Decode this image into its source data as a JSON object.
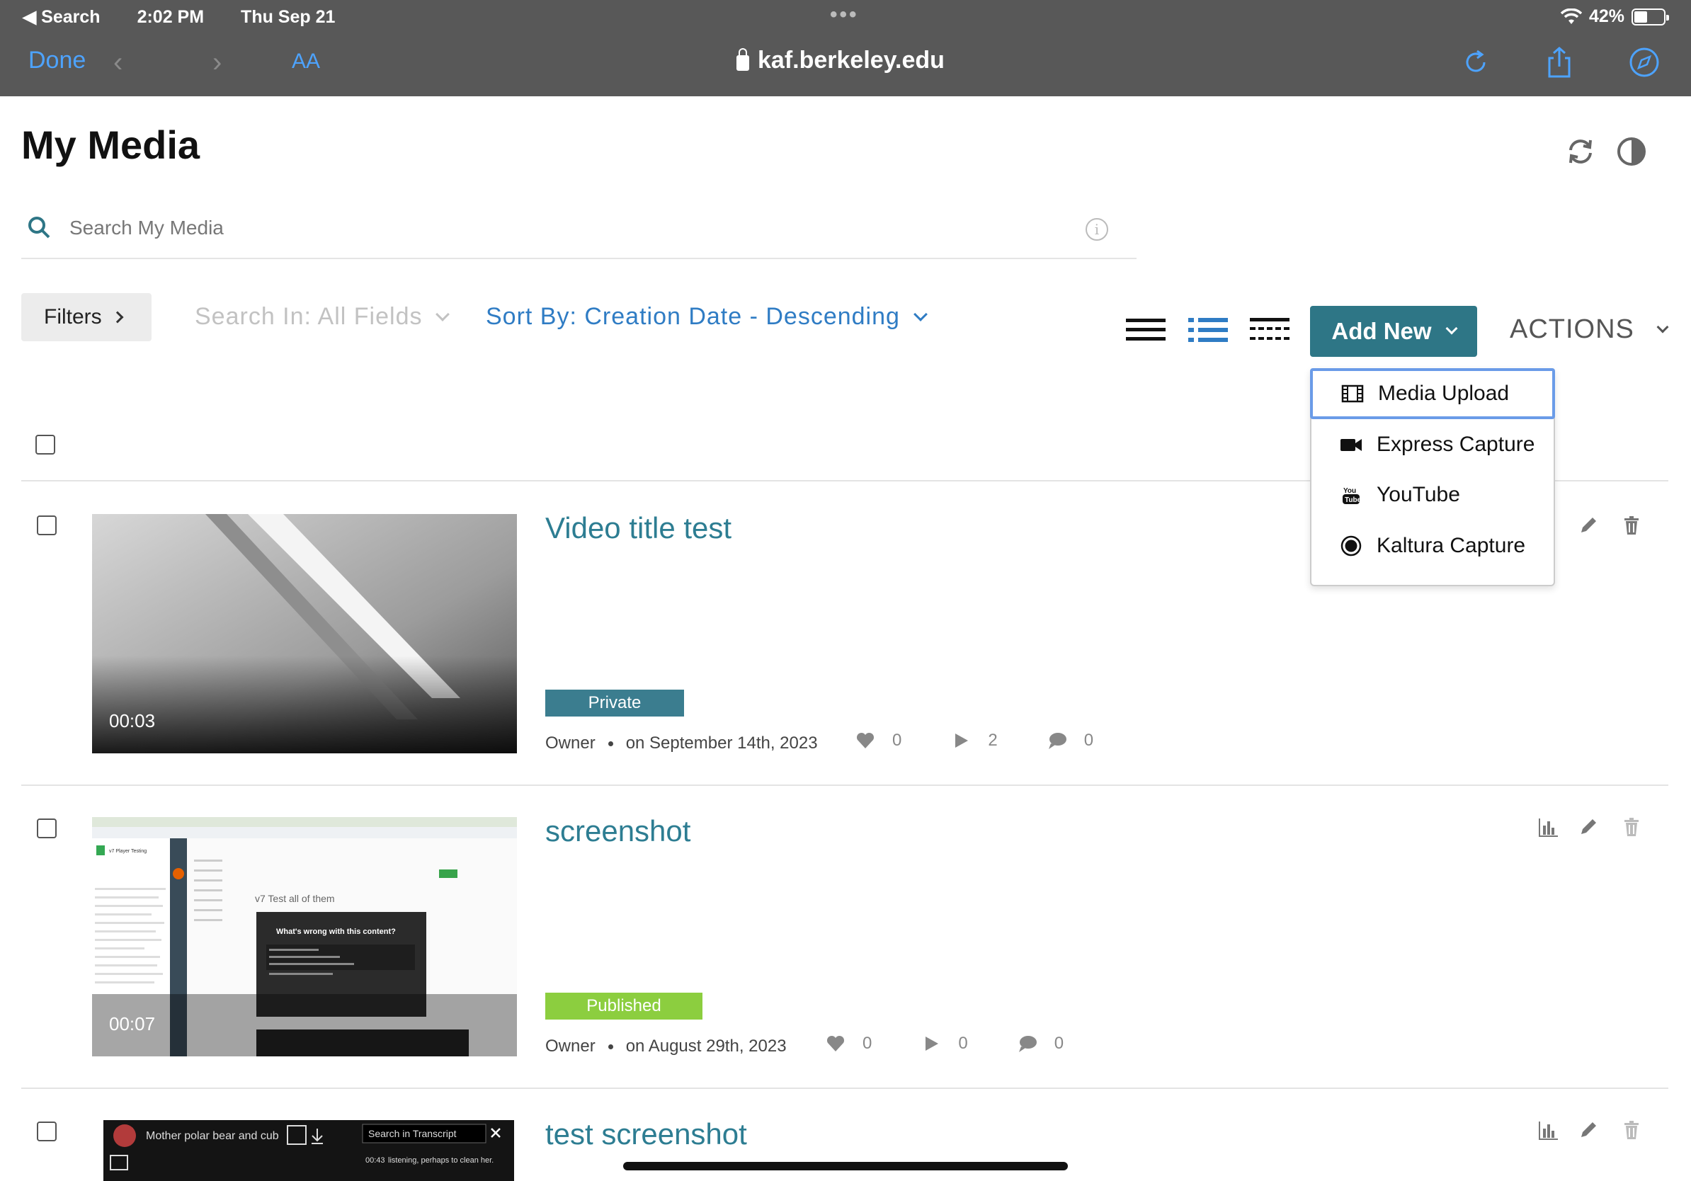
{
  "status_bar": {
    "back_label": "◀ Search",
    "time": "2:02 PM",
    "date": "Thu Sep 21",
    "battery": "42%"
  },
  "browser": {
    "done_label": "Done",
    "text_size_label": "AA",
    "url": "kaf.berkeley.edu"
  },
  "page": {
    "title": "My Media"
  },
  "search": {
    "placeholder": "Search My Media",
    "info_icon": "i"
  },
  "toolbar": {
    "filters_label": "Filters",
    "search_in_label": "Search In: All Fields",
    "sort_by_label": "Sort By: Creation Date - Descending",
    "add_new_label": "Add New",
    "actions_label": "ACTIONS"
  },
  "add_new_menu": {
    "items": [
      {
        "label": "Media Upload",
        "icon": "film-icon"
      },
      {
        "label": "Express Capture",
        "icon": "video-camera-icon"
      },
      {
        "label": "YouTube",
        "icon": "youtube-icon"
      },
      {
        "label": "Kaltura Capture",
        "icon": "record-icon"
      }
    ]
  },
  "media": [
    {
      "title": "Video title test",
      "duration": "00:03",
      "status": "Private",
      "status_color": "#3b7d8f",
      "owner": "Owner",
      "date": "on September 14th, 2023",
      "likes": "0",
      "plays": "2",
      "comments": "0"
    },
    {
      "title": "screenshot",
      "duration": "00:07",
      "status": "Published",
      "status_color": "#8cce3f",
      "owner": "Owner",
      "date": "on August 29th, 2023",
      "likes": "0",
      "plays": "0",
      "comments": "0",
      "thumb_text": {
        "sheet_title": "v7 Player Testing",
        "content_title": "v7 Test all of them",
        "dialog_title": "What's wrong with this content?"
      }
    },
    {
      "title": "test screenshot",
      "thumb_text": {
        "video_title": "Mother polar bear and cub",
        "transcript_search": "Search in Transcript",
        "timestamp": "00:43",
        "transcript_text": "listening, perhaps to clean her."
      }
    }
  ],
  "colors": {
    "accent": "#2e7686",
    "link": "#2d7d92",
    "sort": "#2f7cc4",
    "browser_blue": "#4da3ff"
  }
}
